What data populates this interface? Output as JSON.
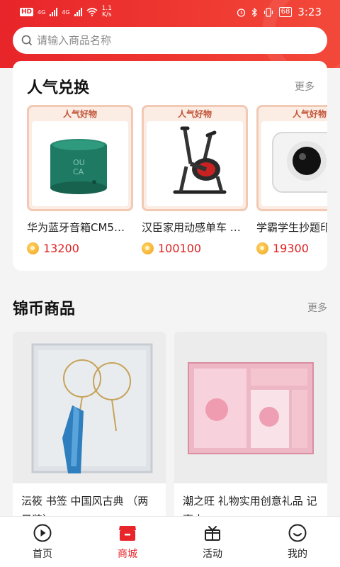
{
  "status_bar": {
    "hd": "HD",
    "sim1": "4G",
    "sim2": "4G",
    "net_speed_value": "1.1",
    "net_speed_unit": "K/s",
    "battery": "68",
    "time": "3:23"
  },
  "search": {
    "placeholder": "请输入商品名称"
  },
  "popular": {
    "title": "人气兑换",
    "more": "更多",
    "items": [
      {
        "tag": "人气好物",
        "name": "华为蓝牙音箱CM5…",
        "price": "13200",
        "icon": "speaker"
      },
      {
        "tag": "人气好物",
        "name": "汉臣家用动感单车 …",
        "price": "100100",
        "icon": "exercise-bike"
      },
      {
        "tag": "人气好物",
        "name": "学霸学生抄题印",
        "price": "19300",
        "icon": "mini-printer"
      }
    ]
  },
  "jinbi": {
    "title": "锦币商品",
    "more": "更多",
    "goods": [
      {
        "name": "沄筱 书签 中国风古典 （两只装）",
        "icon": "bookmark-gift-box"
      },
      {
        "name": "潮之旺 礼物实用创意礼品 记事本",
        "icon": "sakura-notebook-set"
      }
    ]
  },
  "bottom_nav": [
    {
      "label": "首页",
      "icon": "play-circle-icon",
      "active": false
    },
    {
      "label": "商城",
      "icon": "shop-icon",
      "active": true
    },
    {
      "label": "活动",
      "icon": "gift-icon",
      "active": false
    },
    {
      "label": "我的",
      "icon": "smile-icon",
      "active": false
    }
  ],
  "colors": {
    "brand": "#e8252a",
    "price": "#e02020",
    "tag_border": "#f1c9b4"
  }
}
